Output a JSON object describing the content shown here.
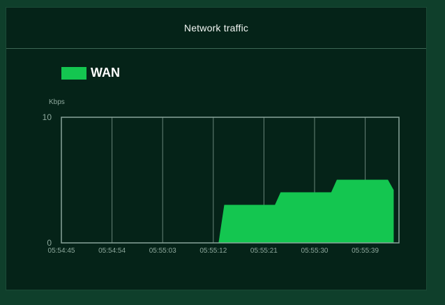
{
  "panel": {
    "title": "Network traffic"
  },
  "colors": {
    "background": "#0f3f2b",
    "panel": "#052318",
    "series": "#14c650",
    "grid": "#8aa59a",
    "text": "#ffffff",
    "muted": "#8ea99d"
  },
  "chart_data": {
    "type": "area",
    "title": "",
    "xlabel": "",
    "ylabel": "Kbps",
    "ylim": [
      0,
      10
    ],
    "yticks": [
      0,
      10
    ],
    "xticks": [
      "05:54:45",
      "05:54:54",
      "05:55:03",
      "05:55:12",
      "05:55:21",
      "05:55:30",
      "05:55:39"
    ],
    "grid": true,
    "legend": "top-left",
    "series": [
      {
        "name": "WAN",
        "color": "#14c650",
        "points": [
          [
            "05:54:45",
            0
          ],
          [
            "05:55:13",
            0
          ],
          [
            "05:55:14",
            3
          ],
          [
            "05:55:23",
            3
          ],
          [
            "05:55:24",
            4
          ],
          [
            "05:55:33",
            4
          ],
          [
            "05:55:34",
            5
          ],
          [
            "05:55:43",
            5
          ],
          [
            "05:55:44",
            4.2
          ]
        ]
      }
    ]
  }
}
